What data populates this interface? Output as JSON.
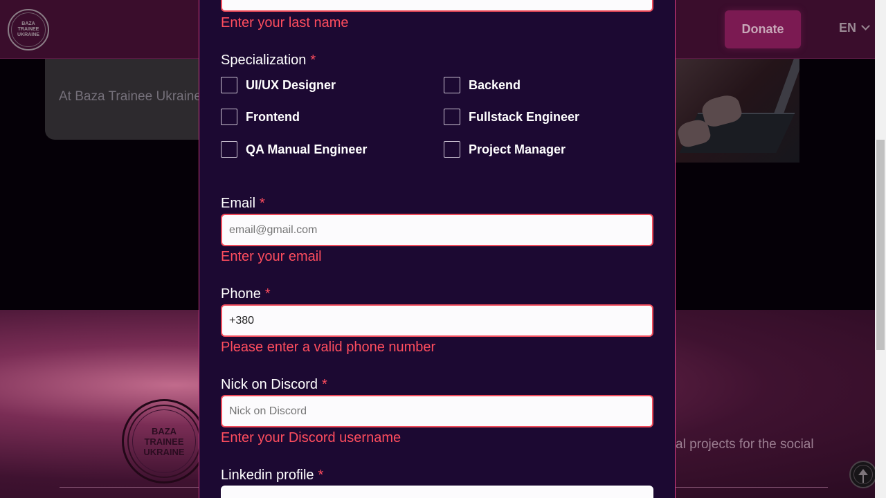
{
  "header": {
    "logo_text": "BAZA TRAINEE UKRAINE",
    "donate_label": "Donate",
    "language": "EN"
  },
  "background": {
    "card_text": "At Baza Trainee Ukraine people at once, contrib",
    "lower_logo_text": "BAZA TRAINEE UKRAINE",
    "lower_text": "al projects for the social"
  },
  "form": {
    "last_name_error": "Enter your last name",
    "specialization": {
      "label": "Specialization",
      "required": "*",
      "options": [
        "UI/UX Designer",
        "Backend",
        "Frontend",
        "Fullstack Engineer",
        "QA Manual Engineer",
        "Project Manager"
      ]
    },
    "email": {
      "label": "Email",
      "required": "*",
      "placeholder": "email@gmail.com",
      "error": "Enter your email"
    },
    "phone": {
      "label": "Phone",
      "required": "*",
      "value": "+380",
      "error": "Please enter a valid phone number"
    },
    "discord": {
      "label": "Nick on Discord",
      "required": "*",
      "placeholder": "Nick on Discord",
      "error": "Enter your Discord username"
    },
    "linkedin": {
      "label": "Linkedin profile",
      "required": "*"
    }
  },
  "colors": {
    "modal_bg": "#1c0932",
    "error": "#ff4d5e",
    "accent": "#d13a82"
  }
}
